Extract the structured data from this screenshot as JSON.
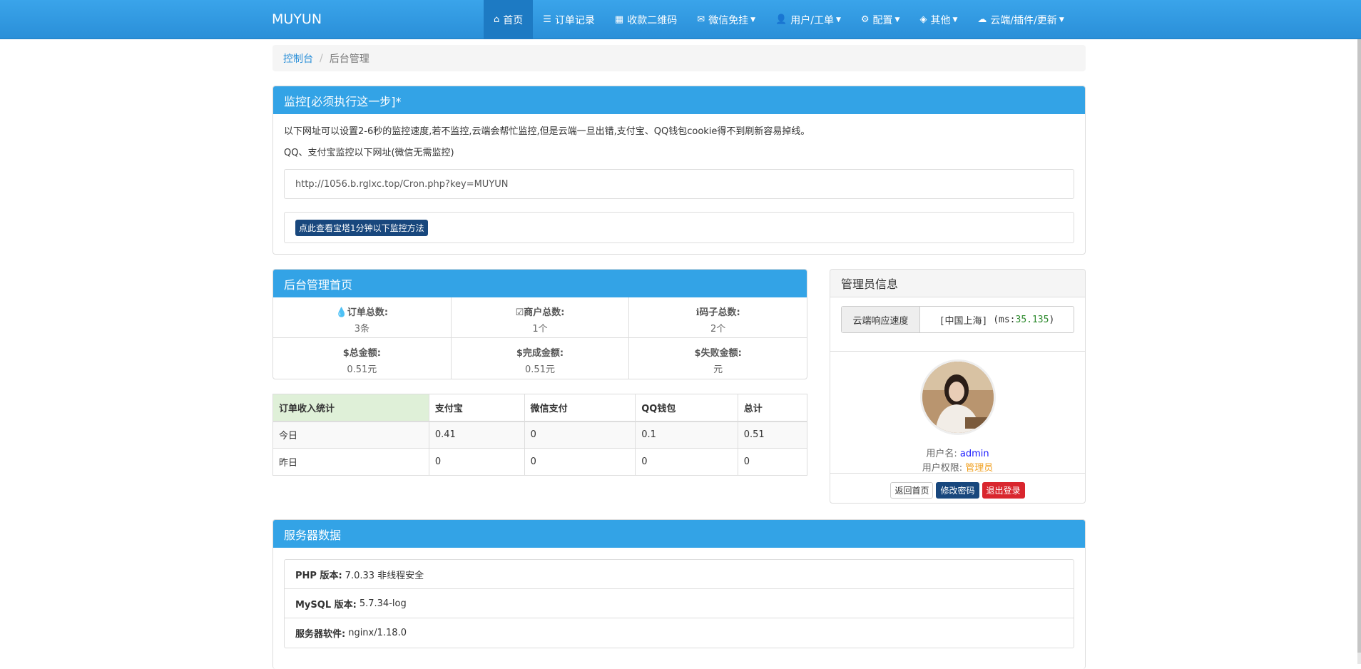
{
  "nav": {
    "brand": "MUYUN",
    "items": [
      {
        "icon": "home-icon",
        "glyph": "⌂",
        "label": "首页",
        "active": true,
        "caret": false
      },
      {
        "icon": "list-icon",
        "glyph": "☰",
        "label": "订单记录",
        "active": false,
        "caret": false
      },
      {
        "icon": "qrcode-icon",
        "glyph": "▦",
        "label": "收款二维码",
        "active": false,
        "caret": false
      },
      {
        "icon": "wechat-icon",
        "glyph": "✉",
        "label": "微信免挂",
        "active": false,
        "caret": true
      },
      {
        "icon": "user-icon",
        "glyph": "👤",
        "label": "用户/工单",
        "active": false,
        "caret": true
      },
      {
        "icon": "gear-icon",
        "glyph": "⚙",
        "label": "配置",
        "active": false,
        "caret": true
      },
      {
        "icon": "cube-icon",
        "glyph": "◈",
        "label": "其他",
        "active": false,
        "caret": true
      },
      {
        "icon": "cloud-icon",
        "glyph": "☁",
        "label": "云端/插件/更新",
        "active": false,
        "caret": true
      }
    ]
  },
  "breadcrumb": {
    "home": "控制台",
    "current": "后台管理"
  },
  "monitor": {
    "title": "监控[必须执行这一步]*",
    "desc1": "以下网址可以设置2-6秒的监控速度,若不监控,云端会帮忙监控,但是云端一旦出错,支付宝、QQ钱包cookie得不到刷新容易掉线。",
    "desc2": "QQ、支付宝监控以下网址(微信无需监控)",
    "url": "http://1056.b.rglxc.top/Cron.php?key=MUYUN",
    "button": "点此查看宝塔1分钟以下监控方法"
  },
  "dashboard": {
    "title": "后台管理首页",
    "stats": [
      {
        "icon": "drop-icon",
        "glyph": "💧",
        "label": "订单总数:",
        "value": "3条"
      },
      {
        "icon": "check-square-icon",
        "glyph": "☑",
        "label": "商户总数:",
        "value": "1个"
      },
      {
        "icon": "info-icon",
        "glyph": "ℹ",
        "label": "码子总数:",
        "value": "2个"
      },
      {
        "icon": "dollar-icon",
        "glyph": "$",
        "label": "总金额:",
        "value": "0.51元"
      },
      {
        "icon": "dollar-icon",
        "glyph": "$",
        "label": "完成金额:",
        "value": "0.51元"
      },
      {
        "icon": "dollar-icon",
        "glyph": "$",
        "label": "失败金额:",
        "value": "元"
      }
    ]
  },
  "income": {
    "headers": [
      "订单收入统计",
      "支付宝",
      "微信支付",
      "QQ钱包",
      "总计"
    ],
    "rows": [
      [
        "今日",
        "0.41",
        "0",
        "0.1",
        "0.51"
      ],
      [
        "昨日",
        "0",
        "0",
        "0",
        "0"
      ]
    ]
  },
  "admin": {
    "title": "管理员信息",
    "speed_label": "云端响应速度",
    "speed_loc": "[中国上海]",
    "speed_ms_prefix": "(ms:",
    "speed_ms": "35.135",
    "speed_ms_suffix": ")",
    "username_label": "用户名:",
    "username": "admin",
    "role_label": "用户权限:",
    "role": "管理员",
    "btn_home": "返回首页",
    "btn_pwd": "修改密码",
    "btn_logout": "退出登录"
  },
  "server": {
    "title": "服务器数据",
    "rows": [
      {
        "key": "PHP 版本:",
        "value": "7.0.33 非线程安全"
      },
      {
        "key": "MySQL 版本:",
        "value": "5.7.34-log"
      },
      {
        "key": "服务器软件:",
        "value": "nginx/1.18.0"
      }
    ]
  }
}
